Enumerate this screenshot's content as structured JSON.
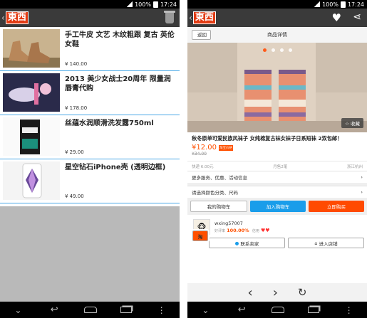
{
  "status": {
    "percent": "100%",
    "time": "17:24"
  },
  "logo": {
    "text": "東西"
  },
  "cart_list": [
    {
      "title": "手工牛皮 文艺 木纹粗跟 复古 英伦 女鞋",
      "price": "¥ 140.00"
    },
    {
      "title": "2013 美少女战士20周年 限量润唇膏代购",
      "price": "¥ 178.00"
    },
    {
      "title": "丝蕴水润顺滑洗发露750ml",
      "price": "¥ 29.00"
    },
    {
      "title": "星空钻石iPhone壳 (透明边框)",
      "price": "¥ 49.00"
    }
  ],
  "detail": {
    "back": "返回",
    "header": "商品详情",
    "favorite": "收藏",
    "title": "秋冬原单可爱民族风袜子 女纯棉复古袜女袜子日系短袜 2双包邮！",
    "price": "¥12.00",
    "price_tag": "淘宝价格",
    "old_price": "¥34.00",
    "shipping": "快递 6.00元",
    "monthly": "月售2笔",
    "location": "浙江杭州",
    "services": "更多服务、优惠、活动信息",
    "choose": "请选择颜色分类、尺码",
    "buttons": {
      "cart": "我的购物车",
      "add": "加入购物车",
      "buy": "立即购买"
    },
    "seller": {
      "name": "wxing57007",
      "rate_label": "好评率",
      "rate": "100.00%",
      "credit_label": "信用",
      "hearts": "♥♥"
    },
    "contact": "联系卖家",
    "shop": "进入店铺",
    "tao": "淘"
  },
  "colors": {
    "accent": "#ff5000",
    "blue": "#1a9dea",
    "logo_red": "#e23a12"
  }
}
